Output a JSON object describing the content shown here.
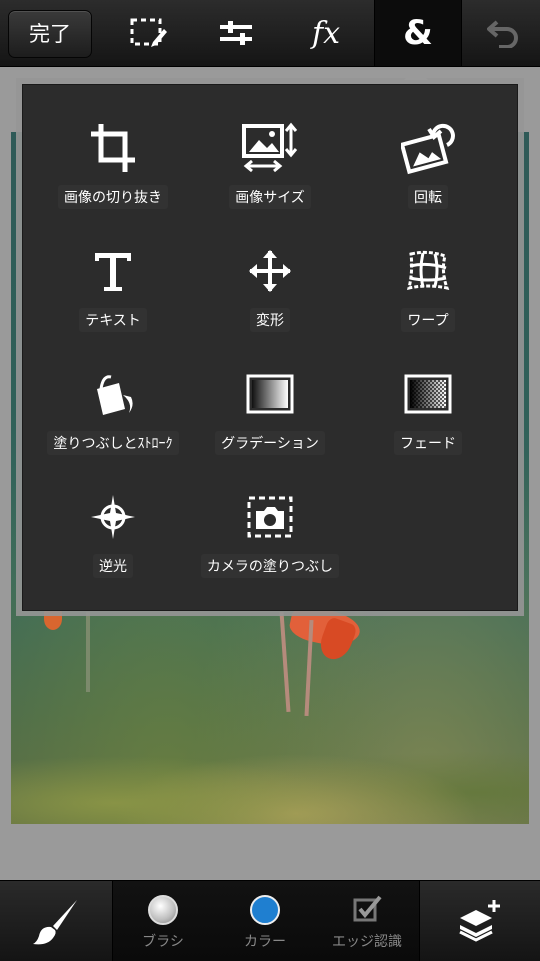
{
  "toolbar": {
    "done_label": "完了",
    "icons": [
      "selection-icon",
      "adjust-sliders-icon",
      "fx-icon",
      "ampersand-icon",
      "undo-icon"
    ],
    "fx_label": "fx",
    "amp_label": "&"
  },
  "popover": {
    "items": [
      {
        "label": "画像の切り抜き",
        "icon": "crop-icon"
      },
      {
        "label": "画像サイズ",
        "icon": "image-size-icon"
      },
      {
        "label": "回転",
        "icon": "rotate-icon"
      },
      {
        "label": "テキスト",
        "icon": "text-icon"
      },
      {
        "label": "変形",
        "icon": "transform-icon"
      },
      {
        "label": "ワープ",
        "icon": "warp-icon"
      },
      {
        "label": "塗りつぶしとｽﾄﾛｰｸ",
        "icon": "fill-stroke-icon"
      },
      {
        "label": "グラデーション",
        "icon": "gradient-icon"
      },
      {
        "label": "フェード",
        "icon": "fade-icon"
      },
      {
        "label": "逆光",
        "icon": "backlight-icon"
      },
      {
        "label": "カメラの塗りつぶし",
        "icon": "camera-fill-icon"
      }
    ]
  },
  "bottombar": {
    "brush_label": "ブラシ",
    "color_label": "カラー",
    "edge_label": "エッジ認識",
    "color_value": "#1f7fd0",
    "brush_color": "#e8e8e8"
  },
  "colors": {
    "panel_bg": "#2c2c2c",
    "toolbar_bg": "#1d1d1d",
    "accent_blue": "#1f7fd0"
  }
}
